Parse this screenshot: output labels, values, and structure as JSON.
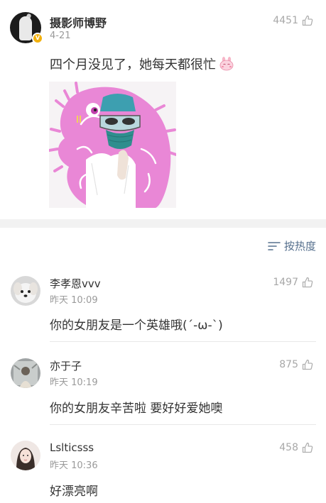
{
  "post": {
    "author": "摄影师博野",
    "date": "4-21",
    "likes": "4451",
    "text": "四个月没见了，她每天都很忙",
    "emoji_icon": "bunny-emoji-icon",
    "verified_badge": "V"
  },
  "sort": {
    "label": "按热度"
  },
  "comments": [
    {
      "name": "李孝恩vvv",
      "time": "昨天 10:09",
      "likes": "1497",
      "text": "你的女朋友是一个英雄哦(´-ω-`)"
    },
    {
      "name": "亦于子",
      "time": "昨天 10:19",
      "likes": "875",
      "text": "你的女朋友辛苦啦 要好好爱她噢"
    },
    {
      "name": "Lslticsss",
      "time": "昨天 10:36",
      "likes": "458",
      "text": "好漂亮啊"
    }
  ],
  "colors": {
    "link_blue": "#56708e",
    "meta_gray": "#9a9a9a",
    "badge_gold": "#f2b10e",
    "sticker_pink": "#e987d6"
  }
}
